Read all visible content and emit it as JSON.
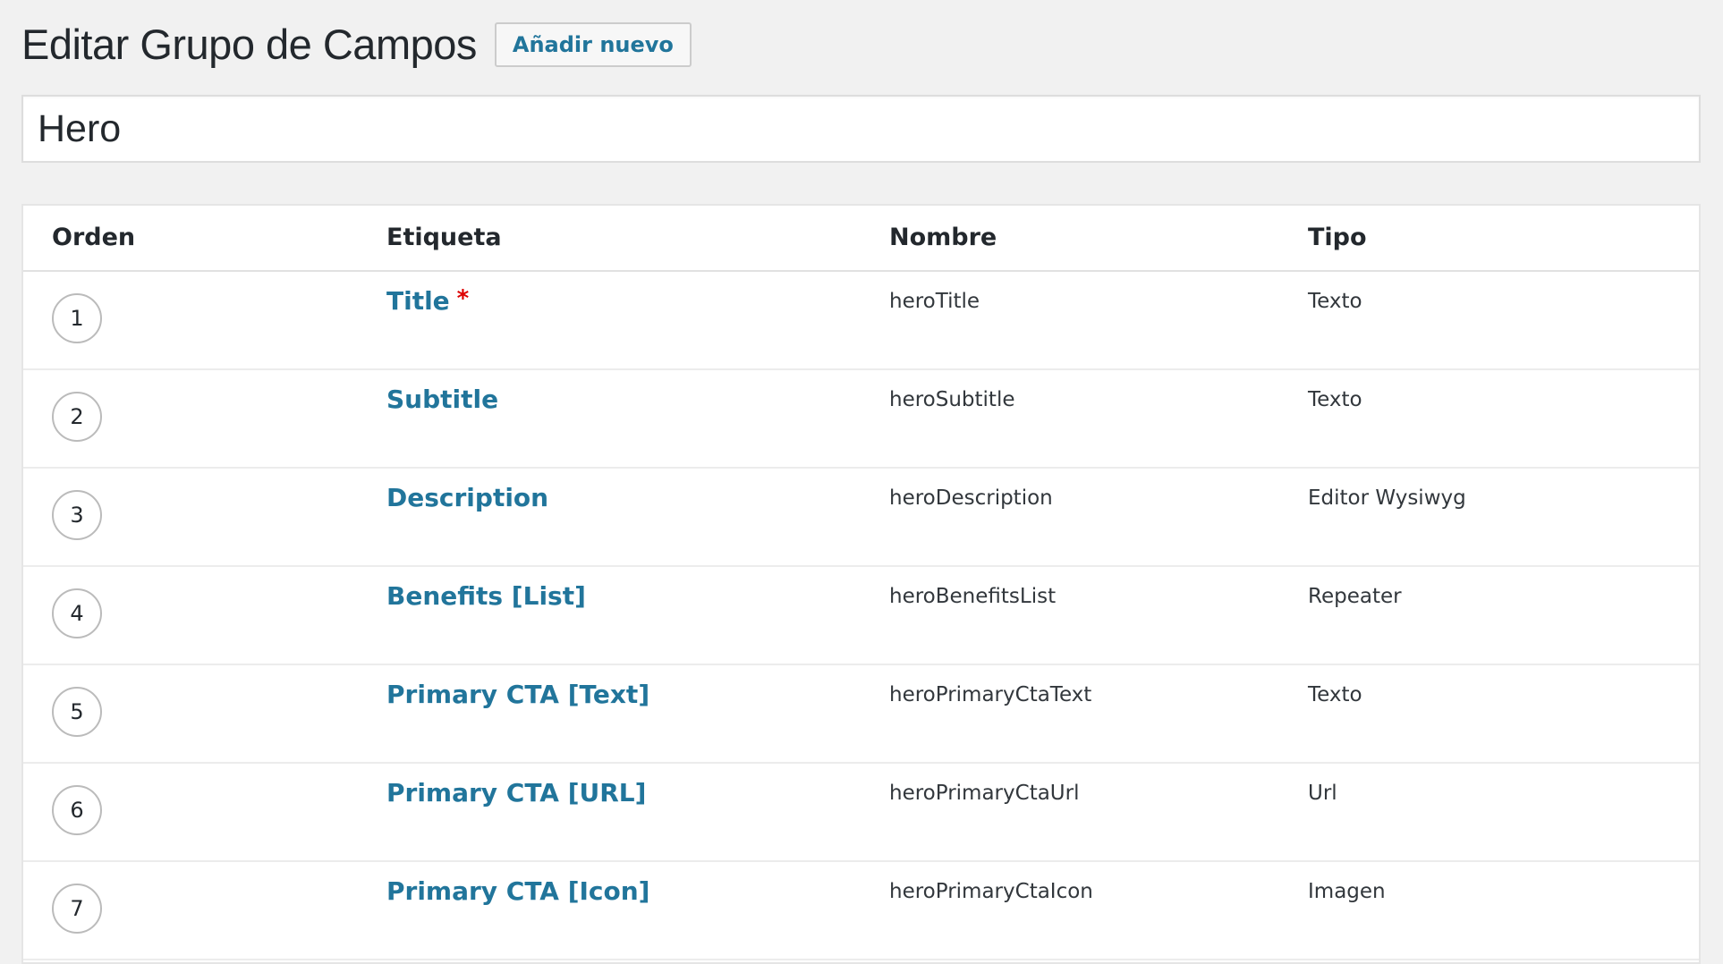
{
  "header": {
    "title": "Editar Grupo de Campos",
    "add_new_label": "Añadir nuevo"
  },
  "group_title": {
    "value": "Hero"
  },
  "table": {
    "columns": {
      "order": "Orden",
      "label": "Etiqueta",
      "name": "Nombre",
      "type": "Tipo"
    },
    "rows": [
      {
        "order": "1",
        "label": "Title",
        "required": "*",
        "name": "heroTitle",
        "type": "Texto"
      },
      {
        "order": "2",
        "label": "Subtitle",
        "name": "heroSubtitle",
        "type": "Texto"
      },
      {
        "order": "3",
        "label": "Description",
        "name": "heroDescription",
        "type": "Editor Wysiwyg"
      },
      {
        "order": "4",
        "label": "Benefits [List]",
        "name": "heroBenefitsList",
        "type": "Repeater"
      },
      {
        "order": "5",
        "label": "Primary CTA [Text]",
        "name": "heroPrimaryCtaText",
        "type": "Texto"
      },
      {
        "order": "6",
        "label": "Primary CTA [URL]",
        "name": "heroPrimaryCtaUrl",
        "type": "Url"
      },
      {
        "order": "7",
        "label": "Primary CTA [Icon]",
        "name": "heroPrimaryCtaIcon",
        "type": "Imagen"
      }
    ]
  },
  "colors": {
    "link": "#21759b",
    "required": "#dd0000",
    "background": "#f1f1f1"
  }
}
